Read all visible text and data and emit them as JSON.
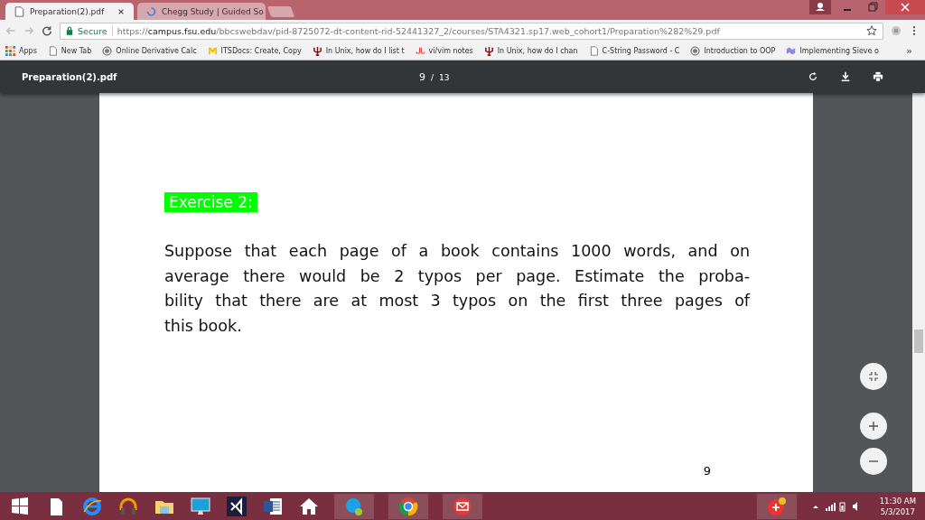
{
  "browser": {
    "tabs": [
      {
        "title": "Preparation(2).pdf",
        "selected": true,
        "kind": "file"
      },
      {
        "title": "Chegg Study | Guided So",
        "selected": false,
        "kind": "loading"
      }
    ],
    "address": {
      "secure_label": "Secure",
      "scheme": "https://",
      "host": "campus.fsu.edu",
      "path": "/bbcswebdav/pid-8725072-dt-content-rid-52441327_2/courses/STA4321.sp17.web_cohort1/Preparation%282%29.pdf"
    },
    "bookmarks": [
      {
        "label": "Apps",
        "kind": "apps"
      },
      {
        "label": "New Tab",
        "kind": "page"
      },
      {
        "label": "Online Derivative Calc",
        "kind": "globe"
      },
      {
        "label": "ITSDocs: Create, Copy",
        "kind": "m"
      },
      {
        "label": "In Unix, how do I list t",
        "kind": "iu"
      },
      {
        "label": "vi/vim notes",
        "kind": "db"
      },
      {
        "label": "In Unix, how do I chan",
        "kind": "iu"
      },
      {
        "label": "C-String Password - C",
        "kind": "page"
      },
      {
        "label": "Introduction to OOP",
        "kind": "globe"
      },
      {
        "label": "Implementing Sieve o",
        "kind": "sieve"
      }
    ],
    "overflow": "»"
  },
  "pdf_viewer": {
    "file_name": "Preparation(2).pdf",
    "current_page": "9",
    "page_separator": "/",
    "total_pages": "13",
    "page": {
      "heading": "Exercise 2:",
      "paragraph_lines": [
        "Suppose that each page of a book contains 1000 words, and on",
        "average there would be 2 typos per page. Estimate the proba-",
        "bility that there are at most 3 typos on the first three pages of",
        "this book."
      ],
      "page_number": "9"
    }
  },
  "taskbar": {
    "time": "11:30 AM",
    "date": "5/3/2017"
  }
}
